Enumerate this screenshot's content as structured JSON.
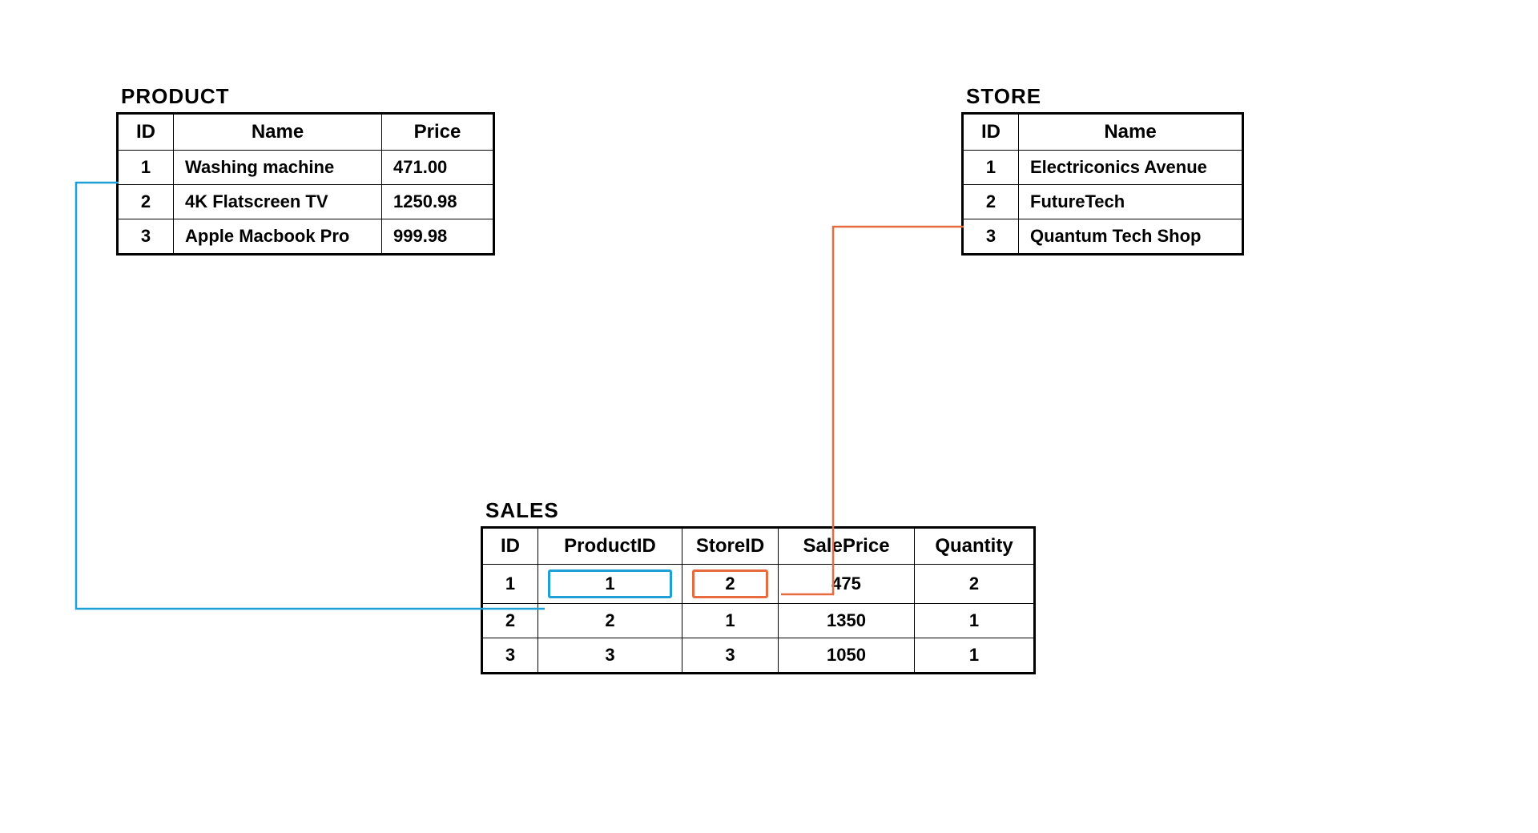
{
  "product": {
    "title": "PRODUCT",
    "headers": [
      "ID",
      "Name",
      "Price"
    ],
    "rows": [
      {
        "id": "1",
        "name": "Washing machine",
        "price": "471.00"
      },
      {
        "id": "2",
        "name": "4K Flatscreen TV",
        "price": "1250.98"
      },
      {
        "id": "3",
        "name": "Apple Macbook Pro",
        "price": "999.98"
      }
    ]
  },
  "store": {
    "title": "STORE",
    "headers": [
      "ID",
      "Name"
    ],
    "rows": [
      {
        "id": "1",
        "name": "Electriconics Avenue"
      },
      {
        "id": "2",
        "name": "FutureTech"
      },
      {
        "id": "3",
        "name": "Quantum Tech Shop"
      }
    ]
  },
  "sales": {
    "title": "SALES",
    "headers": [
      "ID",
      "ProductID",
      "StoreID",
      "SalePrice",
      "Quantity"
    ],
    "rows": [
      {
        "id": "1",
        "productId": "1",
        "storeId": "2",
        "salePrice": "475",
        "quantity": "2"
      },
      {
        "id": "2",
        "productId": "2",
        "storeId": "1",
        "salePrice": "1350",
        "quantity": "1"
      },
      {
        "id": "3",
        "productId": "3",
        "storeId": "3",
        "salePrice": "1050",
        "quantity": "1"
      }
    ]
  },
  "connectors": {
    "blue_color": "#1e9fd6",
    "orange_color": "#e86a3f"
  }
}
